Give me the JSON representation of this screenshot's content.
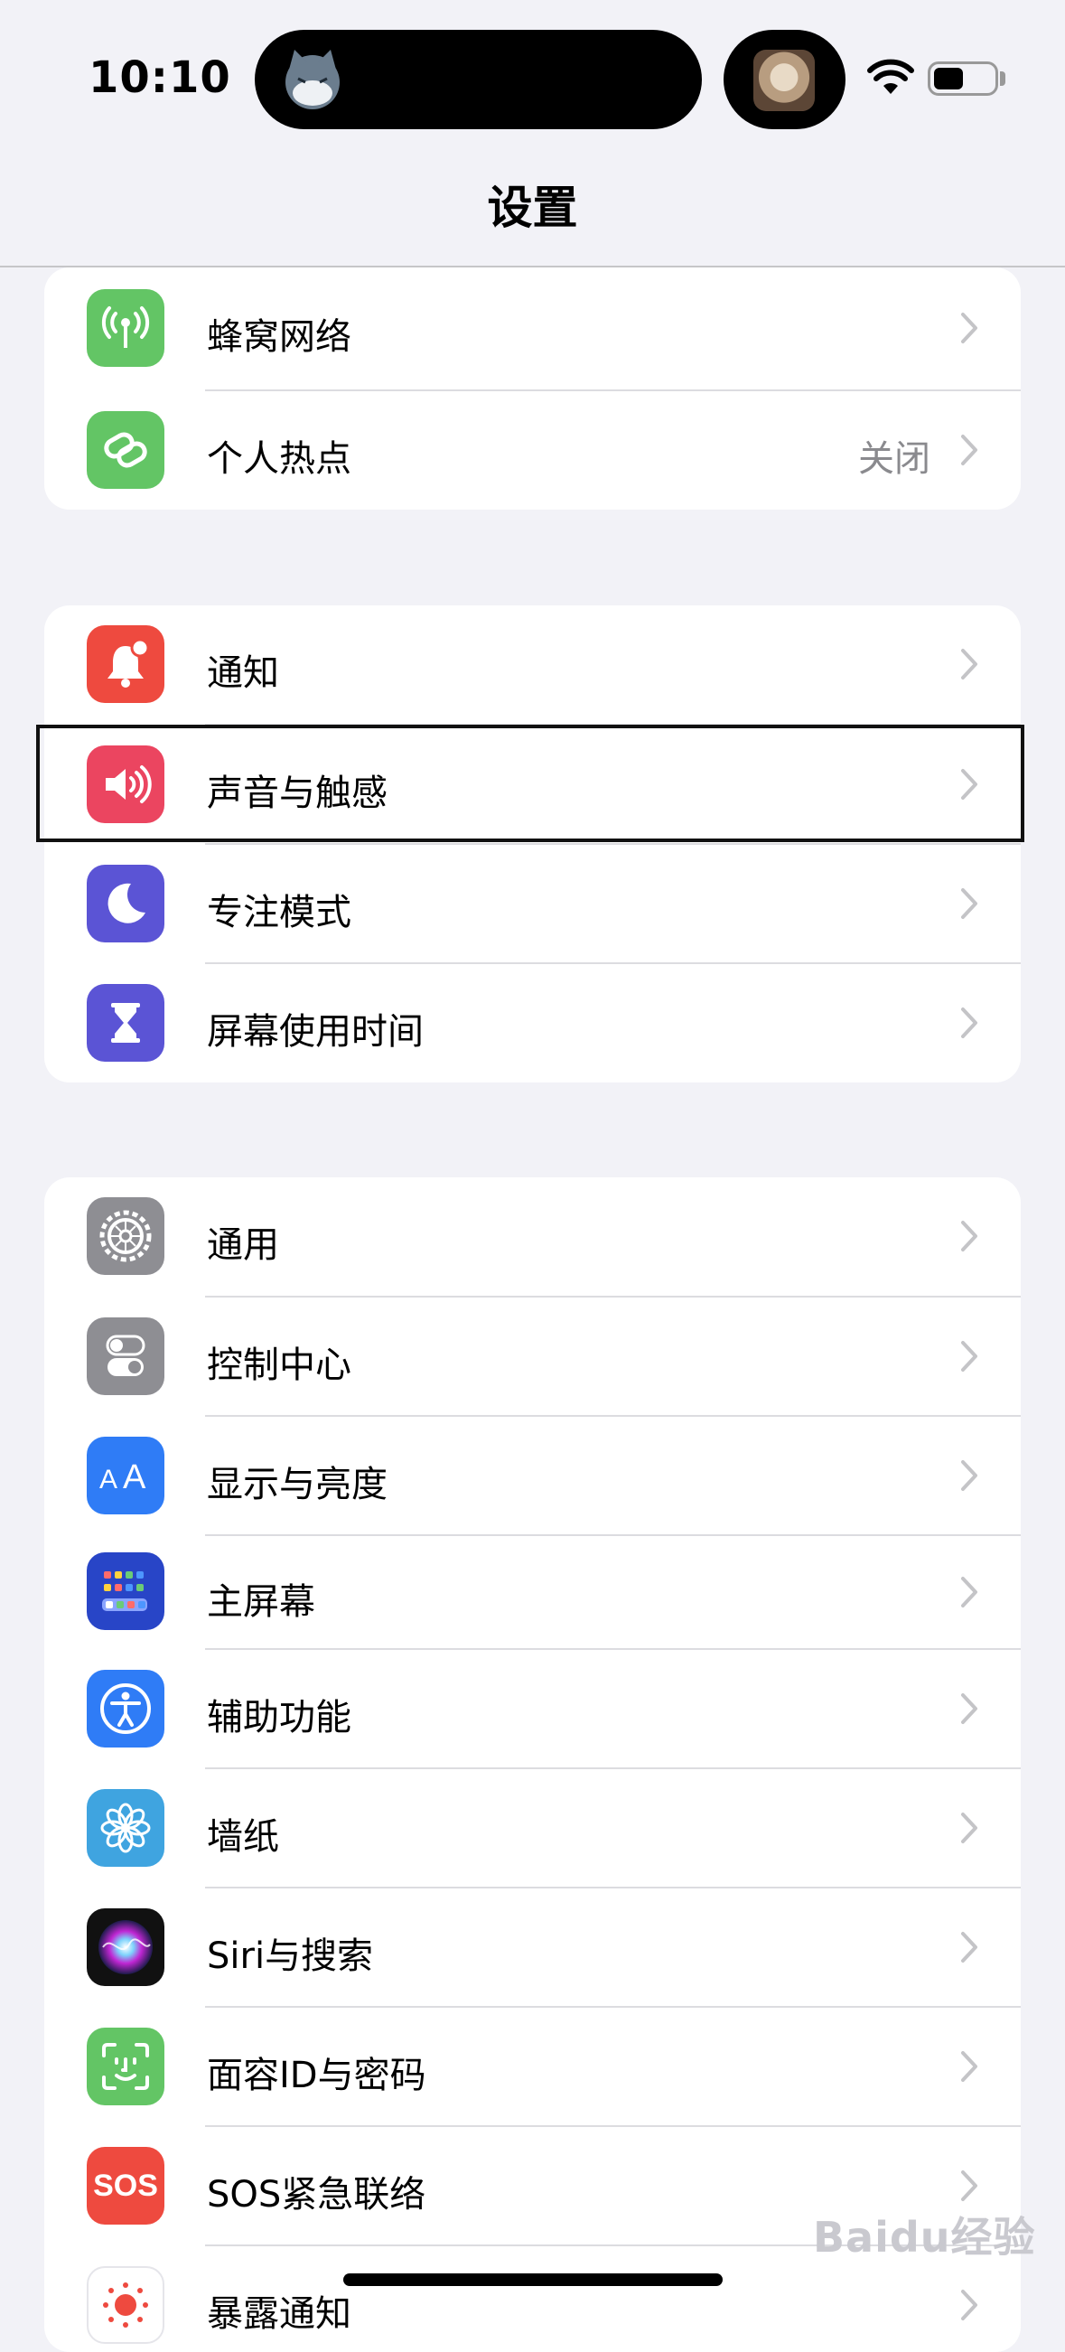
{
  "status_bar": {
    "time": "10:10"
  },
  "nav": {
    "title": "设置"
  },
  "group1": [
    {
      "label": "蜂窝网络",
      "icon": "cellular-antenna-icon",
      "color": "#63c565"
    },
    {
      "label": "个人热点",
      "value": "关闭",
      "icon": "hotspot-link-icon",
      "color": "#63c565"
    }
  ],
  "group2": [
    {
      "label": "通知",
      "icon": "notification-bell-icon",
      "color": "#ee4a3f"
    },
    {
      "label": "声音与触感",
      "icon": "speaker-icon",
      "color": "#eb4560"
    },
    {
      "label": "专注模式",
      "icon": "moon-icon",
      "color": "#5b54d5"
    },
    {
      "label": "屏幕使用时间",
      "icon": "hourglass-icon",
      "color": "#5b54d5"
    }
  ],
  "group3": [
    {
      "label": "通用",
      "icon": "gear-icon",
      "color": "#8e8e93"
    },
    {
      "label": "控制中心",
      "icon": "toggle-switches-icon",
      "color": "#8e8e93"
    },
    {
      "label": "显示与亮度",
      "icon": "text-size-aa-icon",
      "color": "#2f7cf6"
    },
    {
      "label": "主屏幕",
      "icon": "home-screen-grid-icon",
      "color": "#2845c7"
    },
    {
      "label": "辅助功能",
      "icon": "accessibility-icon",
      "color": "#2f7cf6"
    },
    {
      "label": "墙纸",
      "icon": "flower-icon",
      "color": "#3fa4e0"
    },
    {
      "label": "Siri与搜索",
      "icon": "siri-orb-icon",
      "color": "#111111"
    },
    {
      "label": "面容ID与密码",
      "icon": "face-id-icon",
      "color": "#63c565"
    },
    {
      "label": "SOS紧急联络",
      "icon": "sos-icon",
      "color": "#ee4a3f",
      "icon_text": "SOS"
    },
    {
      "label": "暴露通知",
      "icon": "exposure-notification-icon",
      "color": "#ffffff"
    }
  ],
  "watermark": "Baidu经验"
}
